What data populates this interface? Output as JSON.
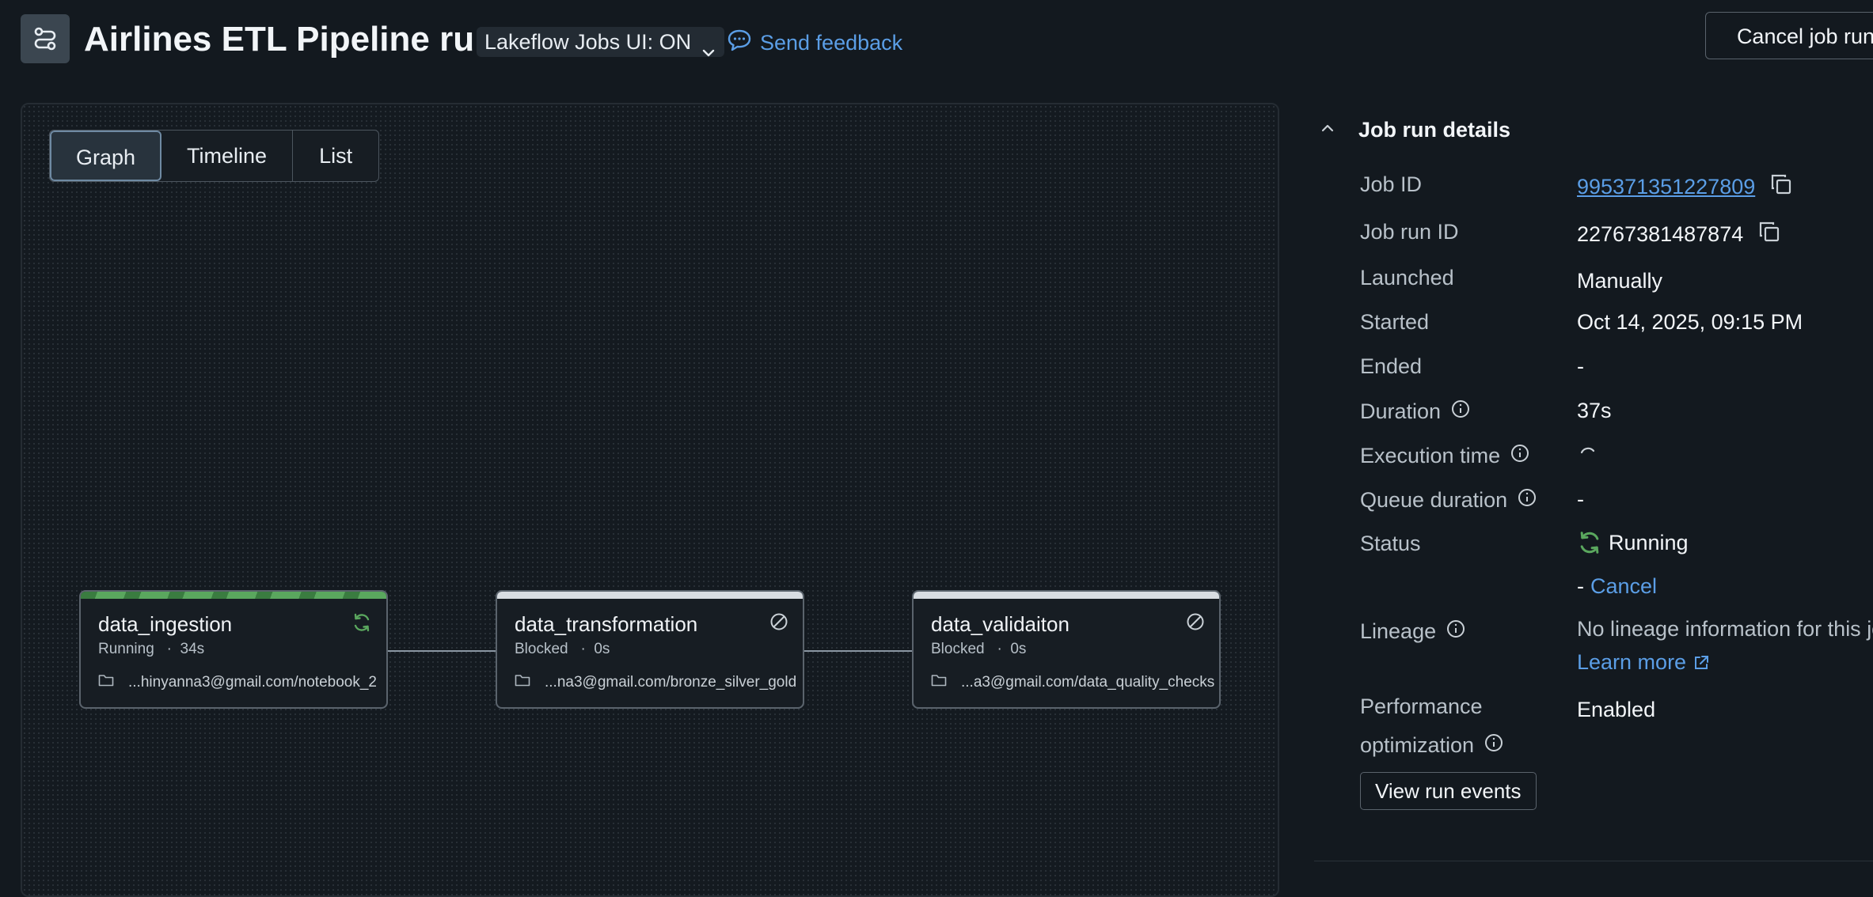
{
  "header": {
    "title": "Airlines ETL Pipeline run",
    "ui_toggle_label": "Lakeflow Jobs UI: ON",
    "feedback_label": "Send feedback",
    "cancel_button_label": "Cancel job run"
  },
  "view_tabs": [
    {
      "label": "Graph",
      "active": true
    },
    {
      "label": "Timeline",
      "active": false
    },
    {
      "label": "List",
      "active": false
    }
  ],
  "tasks": [
    {
      "name": "data_ingestion",
      "status": "Running",
      "duration": "34s",
      "path": "...hinyanna3@gmail.com/notebook_2",
      "icon": "running-sync-icon"
    },
    {
      "name": "data_transformation",
      "status": "Blocked",
      "duration": "0s",
      "path": "...na3@gmail.com/bronze_silver_gold",
      "icon": "blocked-icon"
    },
    {
      "name": "data_validaiton",
      "status": "Blocked",
      "duration": "0s",
      "path": "...a3@gmail.com/data_quality_checks",
      "icon": "blocked-icon"
    }
  ],
  "details": {
    "title": "Job run details",
    "job_id_label": "Job ID",
    "job_id": "995371351227809",
    "job_run_id_label": "Job run ID",
    "job_run_id": "22767381487874",
    "launched_label": "Launched",
    "launched": "Manually",
    "started_label": "Started",
    "started": "Oct 14, 2025, 09:15 PM",
    "ended_label": "Ended",
    "ended": "-",
    "duration_label": "Duration",
    "duration": "37s",
    "execution_time_label": "Execution time",
    "queue_duration_label": "Queue duration",
    "queue_duration": "-",
    "status_label": "Status",
    "status": "Running",
    "cancel_prefix": "-",
    "cancel_link": "Cancel",
    "lineage_label": "Lineage",
    "lineage_text": "No lineage information for this job.",
    "learn_more": "Learn more",
    "perf_label_line1": "Performance",
    "perf_label_line2": "optimization",
    "perf_value": "Enabled",
    "view_events_label": "View run events"
  },
  "colors": {
    "background": "#13191f",
    "link": "#5b9ee6",
    "running_green": "#5aa75e",
    "text": "#f2f5f8",
    "muted": "#b8c1c9"
  }
}
